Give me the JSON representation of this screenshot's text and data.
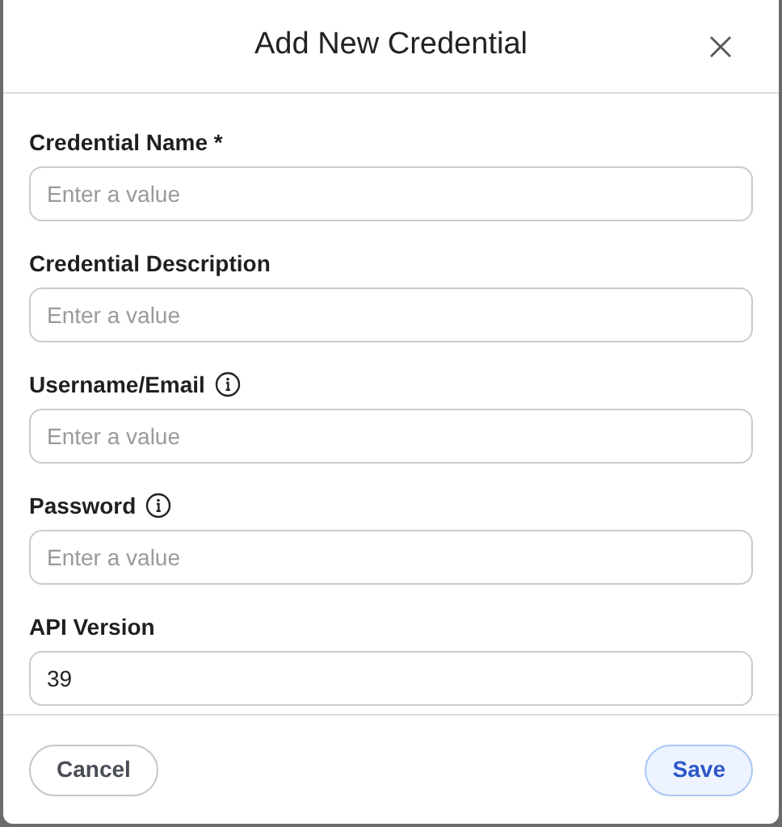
{
  "dialog": {
    "title": "Add New Credential"
  },
  "fields": [
    {
      "label": "Credential Name *",
      "info": false,
      "placeholder": "Enter a value"
    },
    {
      "label": "Credential Description",
      "info": false,
      "placeholder": "Enter a value"
    },
    {
      "label": "Username/Email",
      "info": true,
      "placeholder": "Enter a value"
    },
    {
      "label": "Password",
      "info": true,
      "placeholder": "Enter a value"
    },
    {
      "label": "API Version",
      "info": false,
      "value": "39"
    }
  ],
  "buttons": [
    {
      "label": "Cancel",
      "kind": "secondary"
    },
    {
      "label": "Save",
      "kind": "primary"
    }
  ]
}
